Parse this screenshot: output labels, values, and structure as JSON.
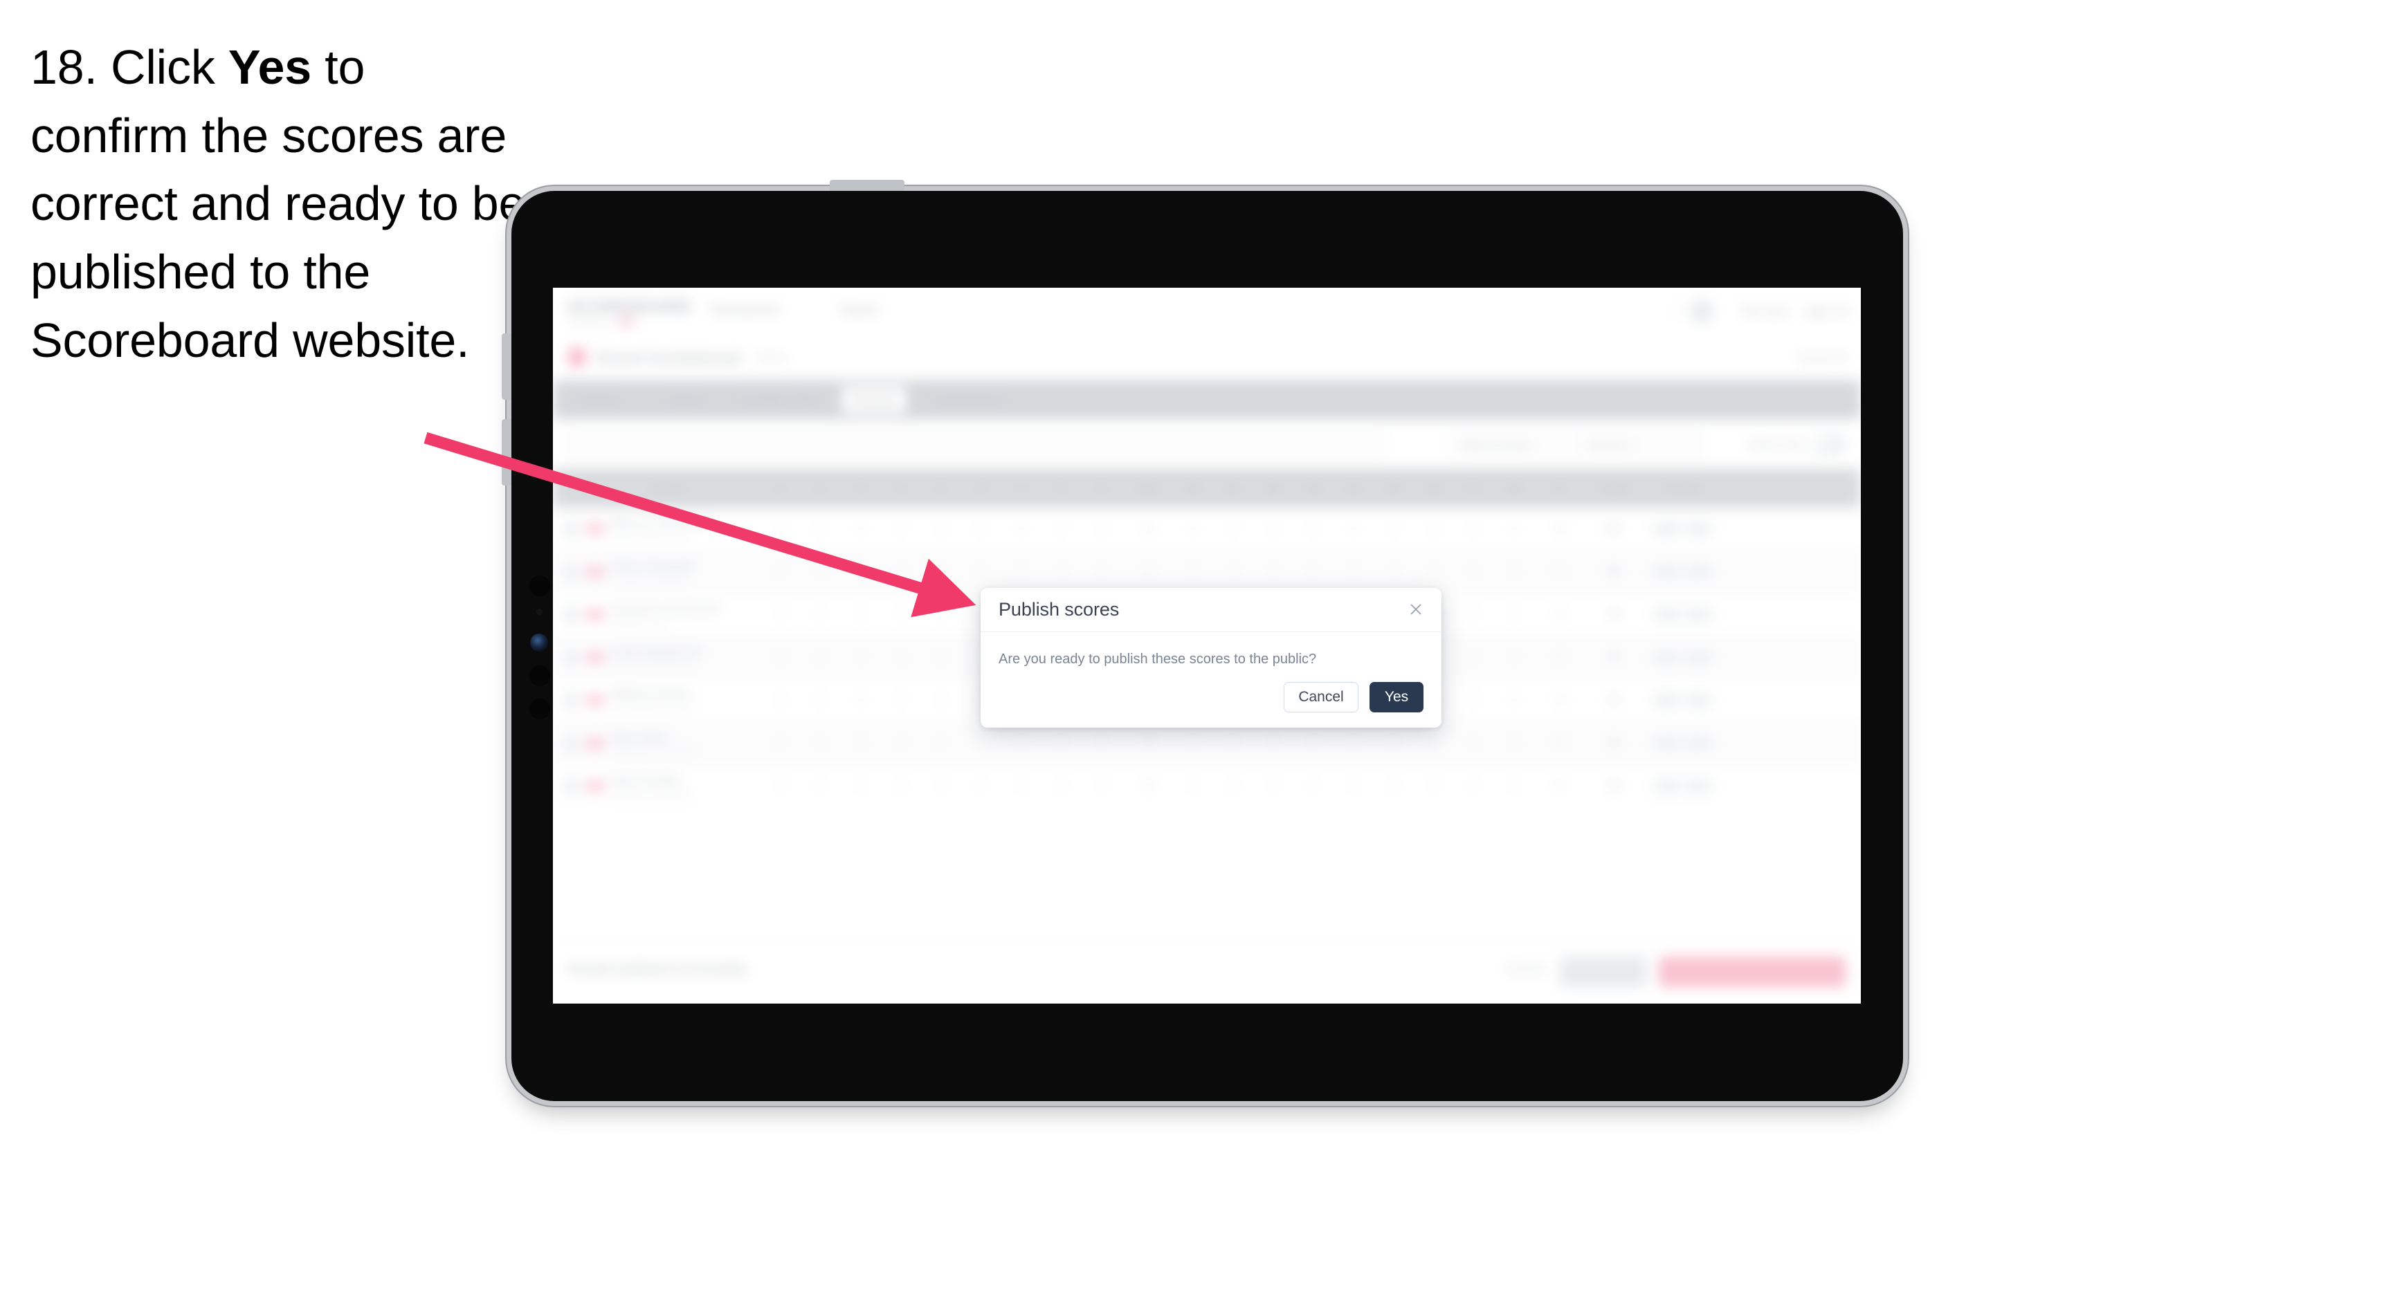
{
  "instruction": {
    "number": "18.",
    "pre": "Click ",
    "bold": "Yes",
    "post": " to confirm the scores are correct and ready to be published to the Scoreboard website."
  },
  "colors": {
    "arrow": "#ef3a6a",
    "primary_button": "#2b3950",
    "accent_pink": "#f9bfcd",
    "device_bezel": "#0b0b0b",
    "device_edge": "#c6c8cb"
  },
  "device": {
    "type": "tablet",
    "orientation": "landscape"
  },
  "app": {
    "header": {
      "brand": "SCOREBOARD",
      "brand_sub": "POWERED BY",
      "nav": [
        "Tournament",
        "Teams"
      ],
      "user": "The User",
      "signout": "Sign out",
      "avatar": "avatar-icon"
    },
    "event": {
      "name": "Event Invitational",
      "year": "2024",
      "action": "Event ID"
    },
    "tabs": [
      {
        "label": "Details",
        "active": false
      },
      {
        "label": "Teams",
        "active": false
      },
      {
        "label": "Coaches Picks",
        "active": false
      },
      {
        "label": "Results",
        "active": true
      },
      {
        "label": "Leaderboard",
        "active": false
      }
    ],
    "filters": {
      "search_placeholder": "Search",
      "select_1": "Filter by team",
      "select_2": "Round 1",
      "toggle_label": "Show only",
      "toggle_on": false
    },
    "table": {
      "columns": [
        "Player",
        "1",
        "2",
        "3",
        "4",
        "5",
        "6",
        "7",
        "8",
        "9",
        "Out",
        "10",
        "11",
        "12",
        "13",
        "14",
        "15",
        "16",
        "17",
        "18",
        "In",
        "Total",
        "Points"
      ],
      "rows": [
        {
          "badge": "1",
          "name": "Marcus Thomson",
          "sub": "Riverside Academy",
          "total": "68",
          "net": "70"
        },
        {
          "badge": "2",
          "name": "Oliver Reynold",
          "sub": "Lakeside Collegiate",
          "total": "69",
          "net": "71"
        },
        {
          "badge": "3",
          "name": "Cameron Anderson",
          "sub": "Northern Prep",
          "total": "70",
          "net": "72"
        },
        {
          "badge": "4",
          "name": "Colin Mackenzie",
          "sub": "Westbrook Highlands",
          "total": "71",
          "net": "73"
        },
        {
          "badge": "5",
          "name": "William Stuart",
          "sub": "Hillcrest Preparatory",
          "total": "72",
          "net": "74"
        },
        {
          "badge": "6",
          "name": "Ryan Blair",
          "sub": "Bridgewater Academy",
          "total": "73",
          "net": "75"
        },
        {
          "badge": "7",
          "name": "Nate Dunbar",
          "sub": "Glenview University",
          "total": "74",
          "net": "76"
        }
      ]
    },
    "footer": {
      "note": "Results published successfully",
      "cancel": "Cancel",
      "save": "Save all",
      "publish": "Publish and notify players"
    }
  },
  "modal": {
    "title": "Publish scores",
    "message": "Are you ready to publish these scores to the public?",
    "cancel_label": "Cancel",
    "confirm_label": "Yes",
    "close_icon": "close-icon"
  }
}
